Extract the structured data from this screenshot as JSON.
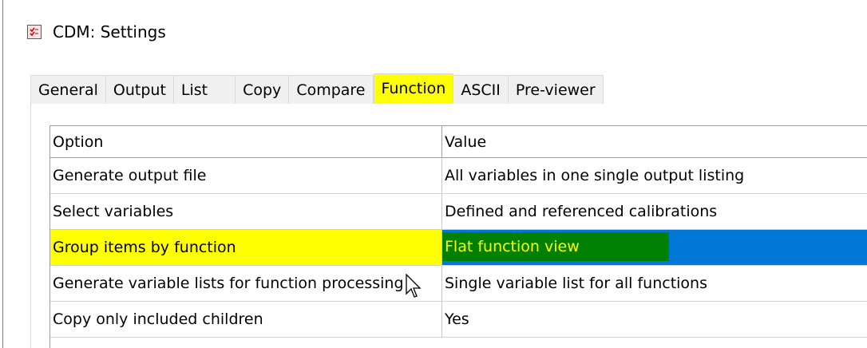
{
  "window": {
    "title": "CDM: Settings",
    "icon": "checklist-icon"
  },
  "tabs": [
    {
      "label": "General"
    },
    {
      "label": "Output"
    },
    {
      "label": "List"
    },
    {
      "label": "Copy"
    },
    {
      "label": "Compare"
    },
    {
      "label": "Function",
      "active": true
    },
    {
      "label": "ASCII"
    },
    {
      "label": "Pre-viewer"
    }
  ],
  "grid": {
    "headers": {
      "option": "Option",
      "value": "Value"
    },
    "rows": [
      {
        "option": "Generate output file",
        "value": "All variables in one single output listing"
      },
      {
        "option": "Select variables",
        "value": "Defined and referenced calibrations"
      },
      {
        "option": "Group items by function",
        "value": "Flat function view",
        "selected": true
      },
      {
        "option": "Generate variable lists for function processing",
        "value": "Single variable list for all functions"
      },
      {
        "option": "Copy only included children",
        "value": "Yes"
      }
    ]
  },
  "colors": {
    "highlight": "#ffff00",
    "selection_blue": "#0078d7",
    "selection_green": "#008000"
  }
}
